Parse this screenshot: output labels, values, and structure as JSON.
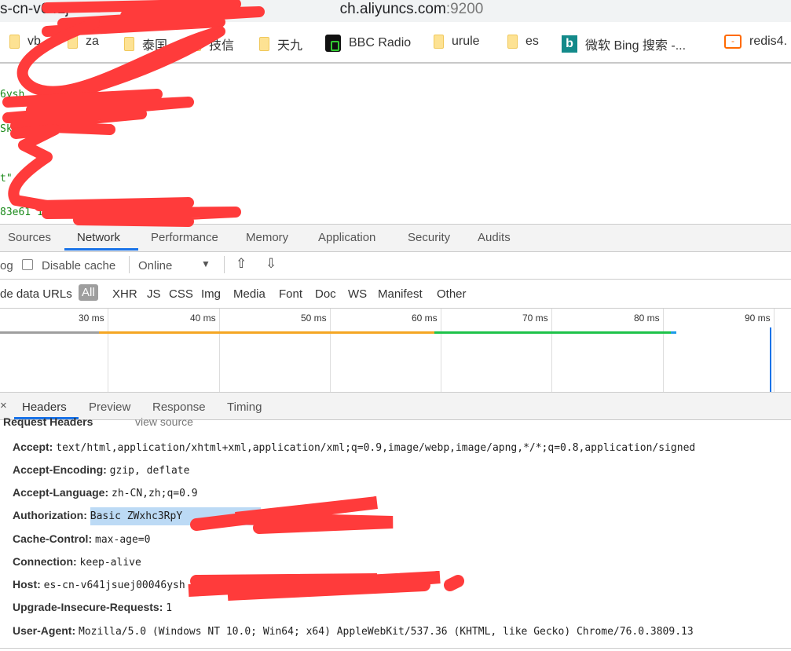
{
  "address_bar": {
    "prefix": "s-cn-v641j",
    "suffix": "ch.aliyuncs.com",
    "port": ":9200"
  },
  "bookmarks": [
    {
      "label": "vb",
      "icon": "folder-icon"
    },
    {
      "label": "za",
      "icon": "folder-icon"
    },
    {
      "label": "泰国",
      "icon": "folder-icon"
    },
    {
      "label": "技信",
      "icon": "folder-icon"
    },
    {
      "label": "天九",
      "icon": "folder-icon"
    },
    {
      "label": "BBC Radio",
      "icon": "radio-icon"
    },
    {
      "label": "urule",
      "icon": "folder-icon"
    },
    {
      "label": "es",
      "icon": "folder-icon"
    },
    {
      "label": "微软 Bing 搜索 -...",
      "icon": "bing-icon"
    },
    {
      "label": "redis4.",
      "icon": "aliyun-icon"
    }
  ],
  "page_lines": [
    "6ysh",
    "Skq",
    "t\"",
    "83e61 198"
  ],
  "devtools": {
    "tabs": [
      "Sources",
      "Network",
      "Performance",
      "Memory",
      "Application",
      "Security",
      "Audits"
    ],
    "active_tab": "Network",
    "toolbar": {
      "log_label": "og",
      "disable_cache": "Disable cache",
      "throttle": "Online"
    },
    "filter": {
      "hide_data_urls": "de data URLs",
      "types": [
        "All",
        "XHR",
        "JS",
        "CSS",
        "Img",
        "Media",
        "Font",
        "Doc",
        "WS",
        "Manifest",
        "Other"
      ],
      "active": "All"
    },
    "timeline_ticks": [
      "30 ms",
      "40 ms",
      "50 ms",
      "60 ms",
      "70 ms",
      "80 ms",
      "90 ms"
    ],
    "subtabs": [
      "Headers",
      "Preview",
      "Response",
      "Timing"
    ],
    "active_subtab": "Headers",
    "section": {
      "title": "Request Headers",
      "view_source": "view source"
    },
    "headers": [
      {
        "name": "Accept:",
        "value": "text/html,application/xhtml+xml,application/xml;q=0.9,image/webp,image/apng,*/*;q=0.8,application/signed"
      },
      {
        "name": "Accept-Encoding:",
        "value": "gzip, deflate"
      },
      {
        "name": "Accept-Language:",
        "value": "zh-CN,zh;q=0.9"
      },
      {
        "name": "Authorization:",
        "value": "Basic ZWxhc3RpY"
      },
      {
        "name": "Cache-Control:",
        "value": "max-age=0"
      },
      {
        "name": "Connection:",
        "value": "keep-alive"
      },
      {
        "name": "Host:",
        "value": "es-cn-v641jsuej00046ysh                              9200"
      },
      {
        "name": "Upgrade-Insecure-Requests:",
        "value": "1"
      },
      {
        "name": "User-Agent:",
        "value": "Mozilla/5.0 (Windows NT 10.0; Win64; x64) AppleWebKit/537.36 (KHTML, like Gecko) Chrome/76.0.3809.13"
      }
    ]
  },
  "colors": {
    "accent": "#1a73e8",
    "redaction": "#ff3b3b",
    "bar_orange": "#f5a623",
    "bar_green": "#1ec24a",
    "selection": "#bcdaf5"
  }
}
